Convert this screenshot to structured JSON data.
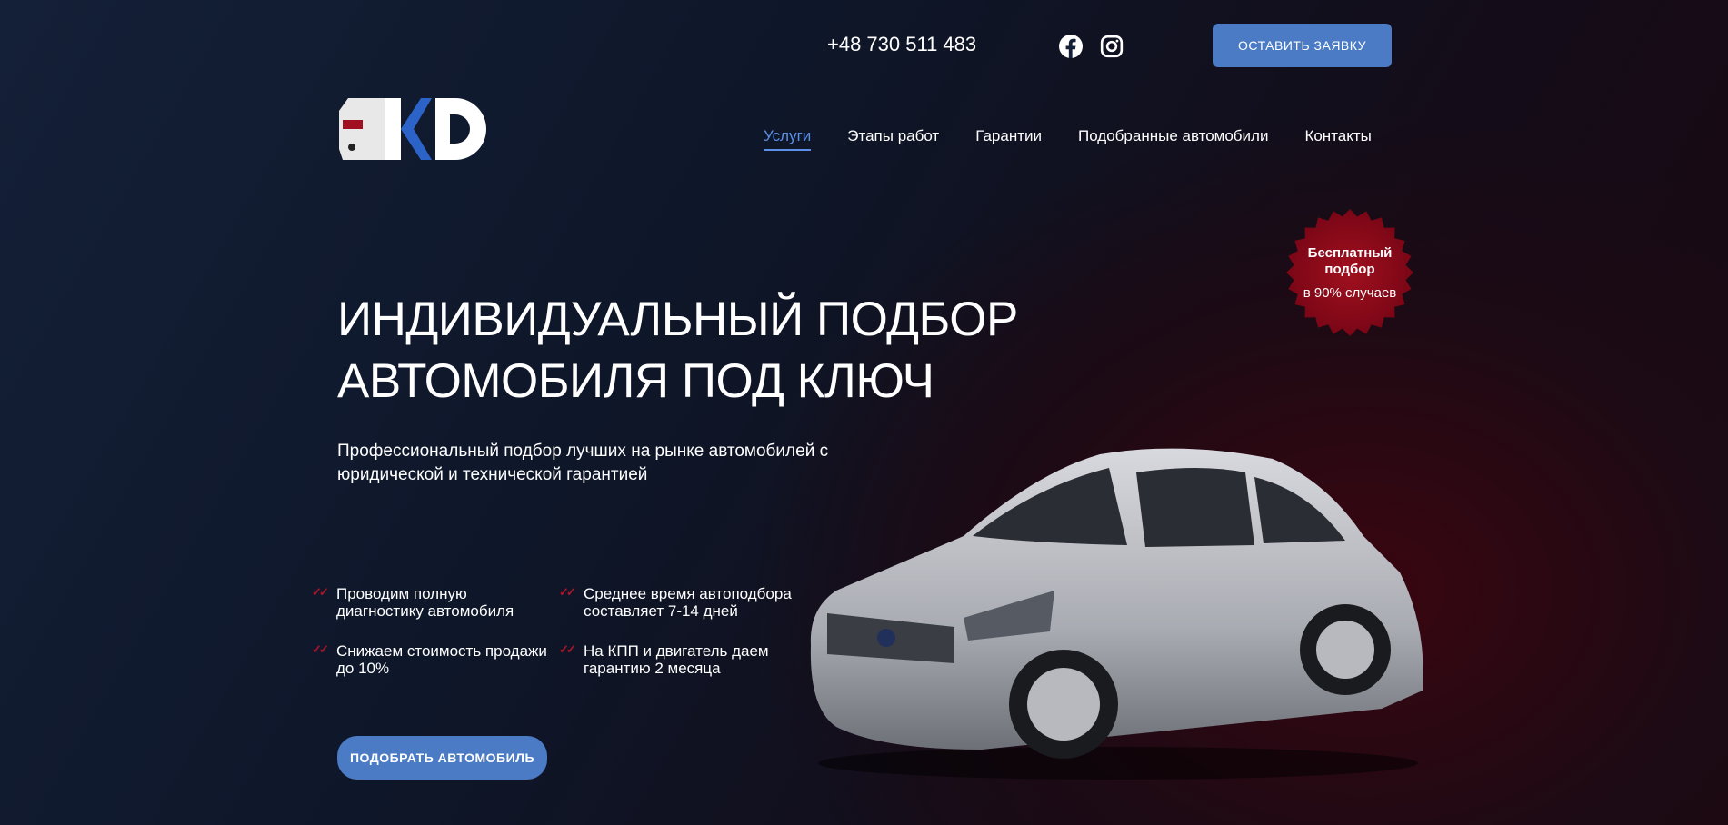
{
  "header": {
    "phone": "+48 730 511 483",
    "cta_label": "ОСТАВИТЬ ЗАЯВКУ",
    "logo_text": "KD",
    "social": [
      {
        "icon": "facebook-icon"
      },
      {
        "icon": "instagram-icon"
      }
    ]
  },
  "nav": {
    "items": [
      {
        "label": "Услуги",
        "active": true
      },
      {
        "label": "Этапы работ"
      },
      {
        "label": "Гарантии"
      },
      {
        "label": "Подобранные автомобили"
      },
      {
        "label": "Контакты"
      }
    ]
  },
  "badge": {
    "line1": "Бесплатный подбор",
    "line2": "в 90% случаев",
    "color": "#8a0a1c"
  },
  "hero": {
    "title_line1": "ИНДИВИДУАЛЬНЫЙ ПОДБОР",
    "title_line2": "АВТОМОБИЛЯ ПОД КЛЮЧ",
    "subtitle": "Профессиональный подбор лучших на рынке автомобилей с юридической и технической гарантией",
    "features": [
      "Проводим полную диагностику автомобиля",
      "Среднее время автоподбора составляет 7-14 дней",
      "Снижаем стоимость продажи до 10%",
      "На КПП и двигатель даем гарантию 2 месяца"
    ],
    "check_mark": "✓✓",
    "cta_label": "ПОДОБРАТЬ АВТОМОБИЛЬ"
  },
  "colors": {
    "accent": "#4a7bc4",
    "nav_active": "#5b8fe8",
    "check": "#b0142a"
  }
}
